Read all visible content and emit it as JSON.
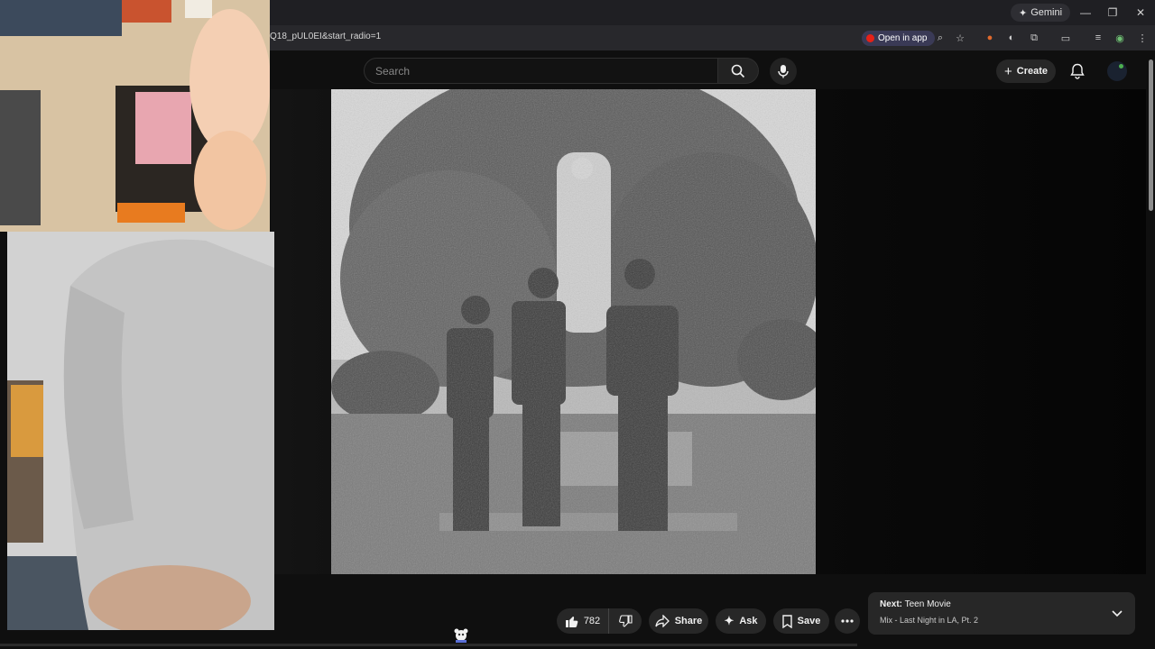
{
  "browser": {
    "gemini_label": "Gemini",
    "url_fragment": "Q18_pUL0EI&start_radio=1",
    "open_in_app_label": "Open in app"
  },
  "header": {
    "search_placeholder": "Search",
    "create_label": "Create"
  },
  "actions": {
    "like_count": "782",
    "share_label": "Share",
    "ask_label": "Ask",
    "save_label": "Save"
  },
  "up_next": {
    "prefix": "Next:",
    "title": "Teen Movie",
    "subtitle": "Mix - Last Night in LA, Pt. 2"
  },
  "icons": {
    "gemini": "sparkle-icon",
    "search": "search-icon",
    "mic": "microphone-icon",
    "create": "plus-icon",
    "notifications": "bell-icon",
    "like": "thumbs-up-icon",
    "dislike": "thumbs-down-icon",
    "share": "share-arrow-icon",
    "ask": "sparkle-icon",
    "save": "bookmark-icon",
    "more": "more-horizontal-icon",
    "expand": "chevron-down-icon"
  },
  "colors": {
    "background": "#0f0f0f",
    "surface": "#272727",
    "youtube_red": "#e62117"
  }
}
